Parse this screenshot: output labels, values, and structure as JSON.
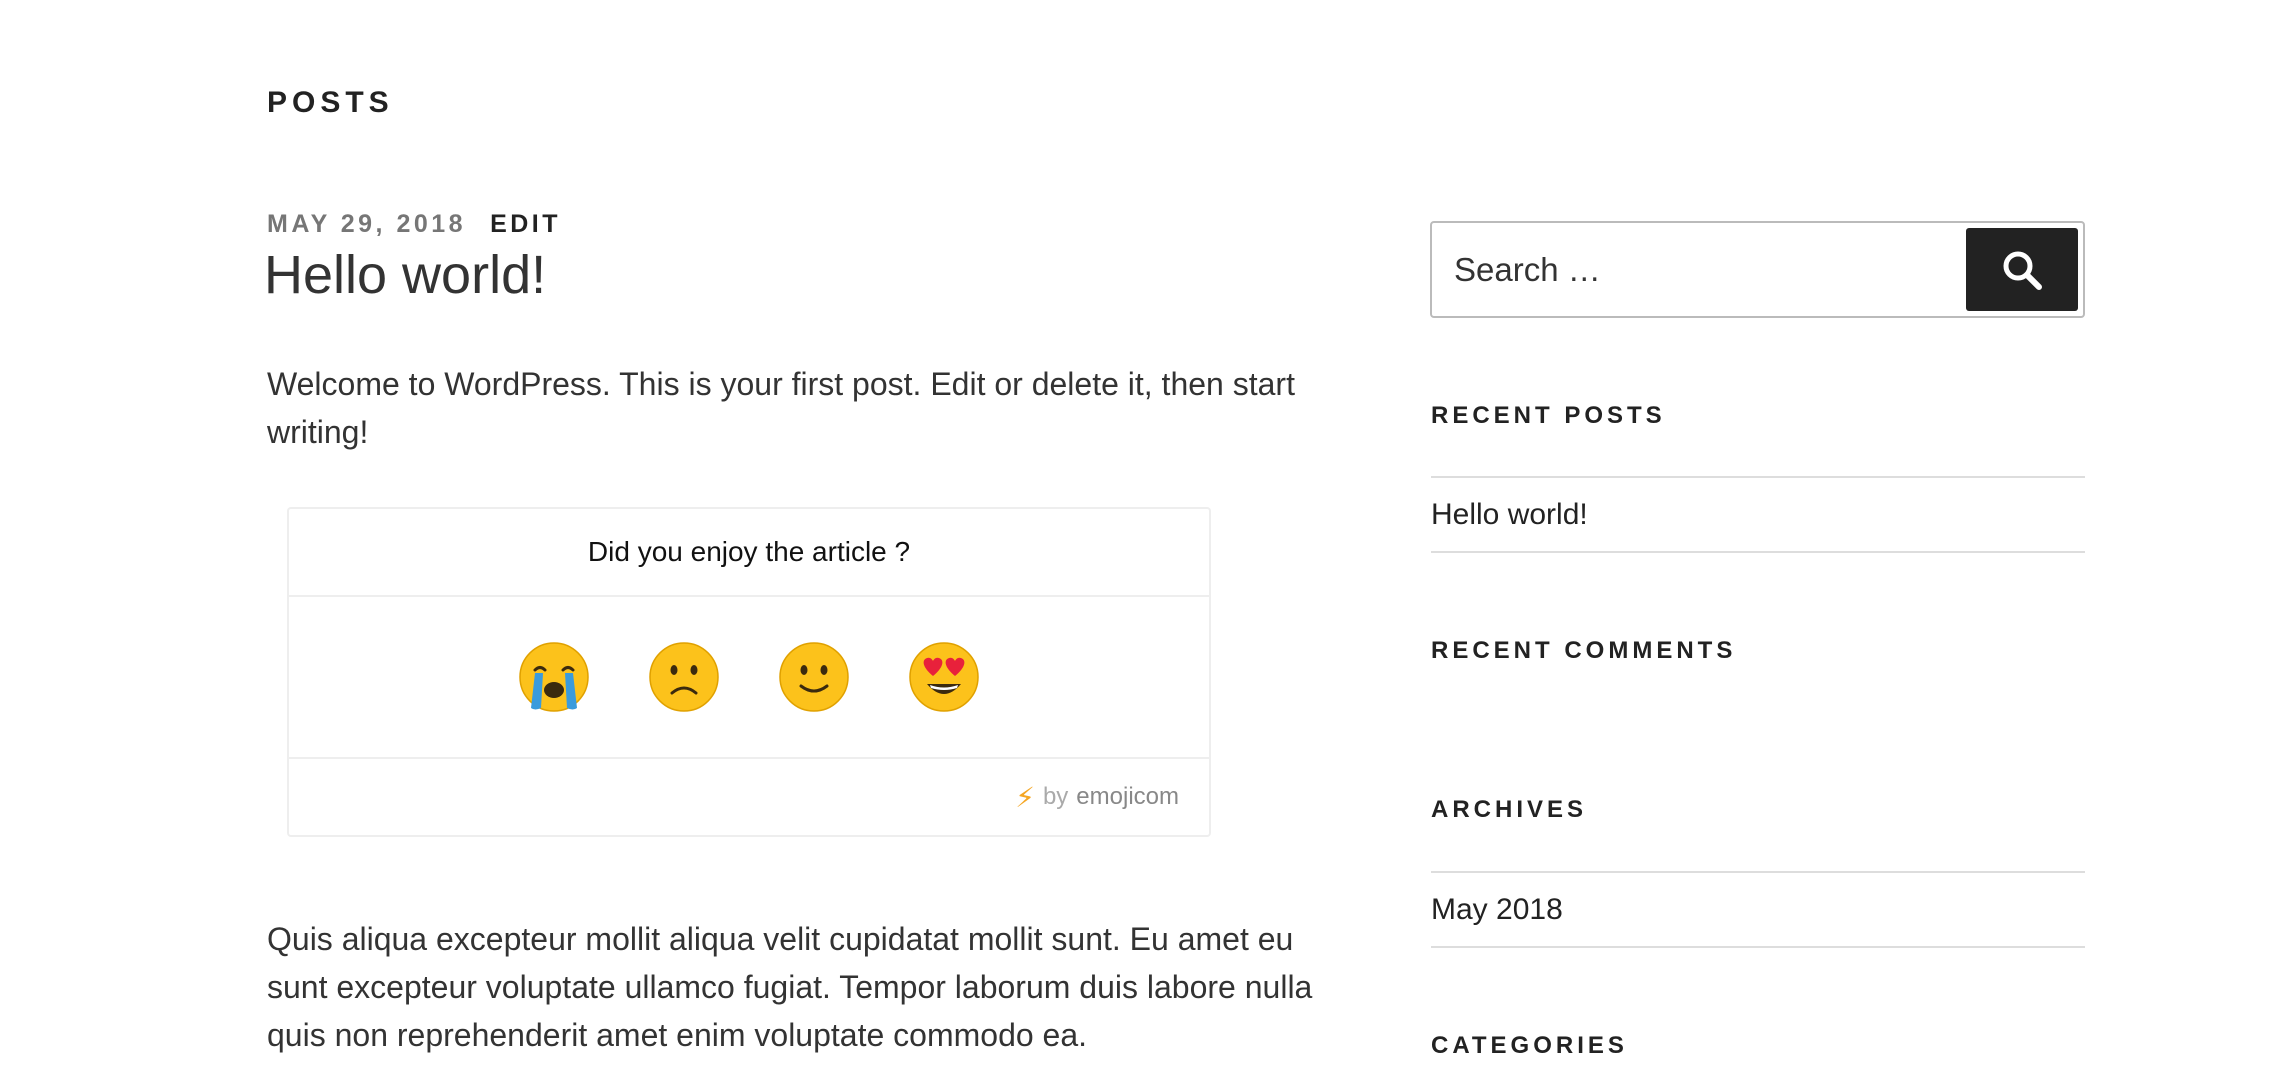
{
  "page": {
    "title": "POSTS"
  },
  "post": {
    "date": "MAY 29, 2018",
    "edit_label": "EDIT",
    "title": "Hello world!",
    "intro": "Welcome to WordPress. This is your first post. Edit or delete it, then start writing!",
    "body": "Quis aliqua excepteur mollit aliqua velit cupidatat mollit sunt. Eu amet eu sunt excepteur voluptate ullamco fugiat. Tempor laborum duis labore nulla quis non reprehenderit amet enim voluptate commodo ea."
  },
  "emoji_widget": {
    "question": "Did you enjoy the article ?",
    "reactions": [
      {
        "icon": "crying-face-icon"
      },
      {
        "icon": "frowning-face-icon"
      },
      {
        "icon": "smiling-face-icon"
      },
      {
        "icon": "heart-eyes-face-icon"
      }
    ],
    "footer": {
      "icon": "lightning-bolt-icon",
      "by_label": "by",
      "brand": "emojicom"
    }
  },
  "sidebar": {
    "search": {
      "placeholder": "Search …",
      "button_icon": "search-icon"
    },
    "recent_posts": {
      "title": "RECENT POSTS",
      "items": [
        "Hello world!"
      ]
    },
    "recent_comments": {
      "title": "RECENT COMMENTS"
    },
    "archives": {
      "title": "ARCHIVES",
      "items": [
        "May 2018"
      ]
    },
    "categories": {
      "title": "CATEGORIES"
    }
  },
  "colors": {
    "text": "#222222",
    "meta_date": "#767676",
    "search_button": "#222222",
    "bolt": "#f5a623",
    "emoji_yellow": "#fcc21b"
  }
}
